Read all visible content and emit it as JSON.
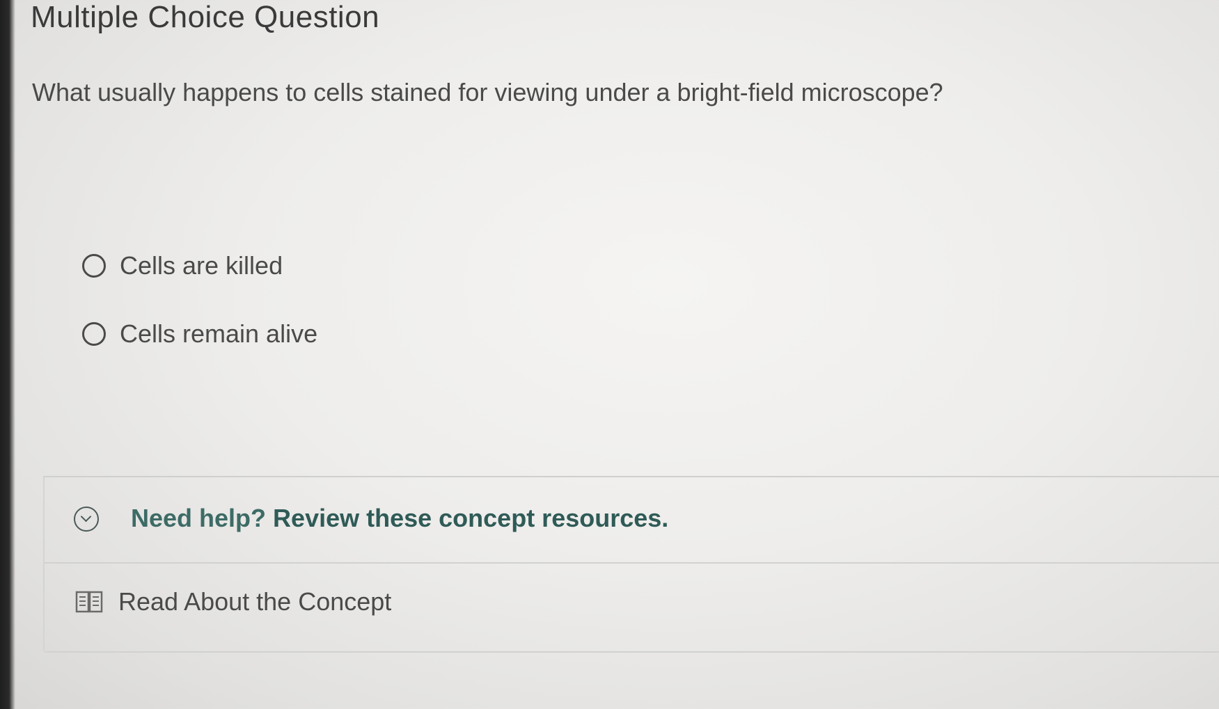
{
  "header": {
    "title": "Multiple Choice Question"
  },
  "question": {
    "text": "What usually happens to cells stained for viewing under a bright-field microscope?"
  },
  "options": [
    {
      "label": "Cells are killed",
      "selected": false
    },
    {
      "label": "Cells remain alive",
      "selected": false
    }
  ],
  "help": {
    "prompt": "Need help?",
    "link_text": "Review these concept resources.",
    "icon": "chevron-down-circle-icon",
    "expanded": true
  },
  "resources": [
    {
      "label": "Read About the Concept",
      "icon": "book-icon"
    }
  ],
  "colors": {
    "accent_teal": "#2f5b57",
    "text_gray": "#4a4a4a"
  }
}
